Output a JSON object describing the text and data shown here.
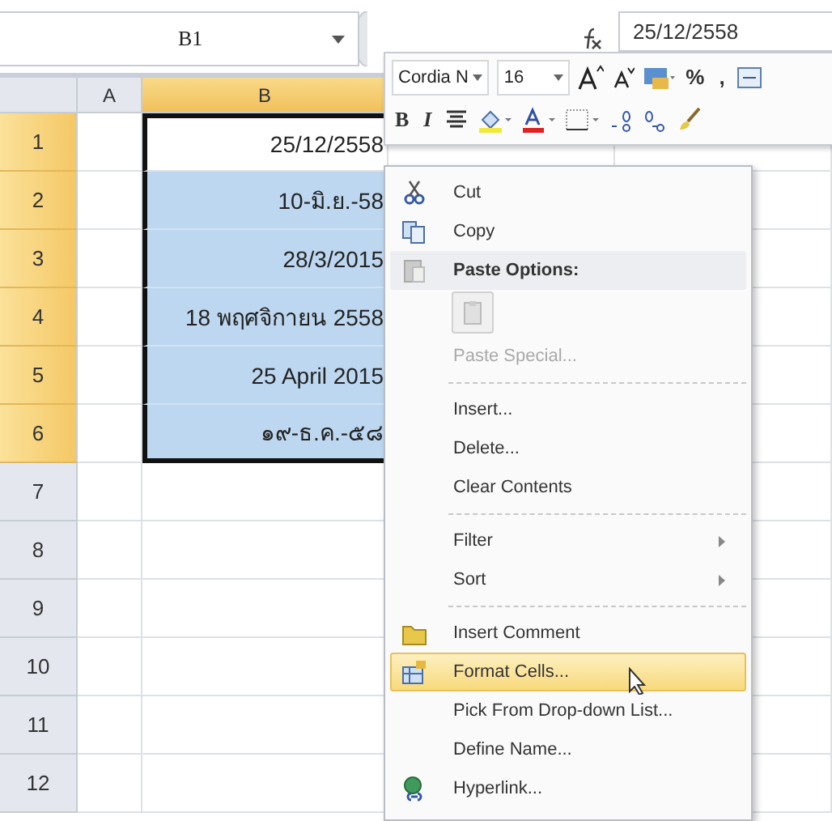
{
  "formula_bar": {
    "name_box": "B1",
    "value": "25/12/2558"
  },
  "columns": [
    {
      "label": "A",
      "selected": false
    },
    {
      "label": "B",
      "selected": true
    }
  ],
  "rows": [
    {
      "label": "1",
      "selected": true,
      "b": {
        "value": "25/12/2558",
        "in_range": true,
        "highlighted": false
      }
    },
    {
      "label": "2",
      "selected": true,
      "b": {
        "value": "10-มิ.ย.-58",
        "in_range": true,
        "highlighted": true
      }
    },
    {
      "label": "3",
      "selected": true,
      "b": {
        "value": "28/3/2015",
        "in_range": true,
        "highlighted": true
      }
    },
    {
      "label": "4",
      "selected": true,
      "b": {
        "value": "18 พฤศจิกายน 2558",
        "in_range": true,
        "highlighted": true
      }
    },
    {
      "label": "5",
      "selected": true,
      "b": {
        "value": "25 April 2015",
        "in_range": true,
        "highlighted": true
      }
    },
    {
      "label": "6",
      "selected": true,
      "b": {
        "value": "๑๙-ธ.ค.-๕๘",
        "in_range": true,
        "highlighted": true
      }
    },
    {
      "label": "7",
      "selected": false
    },
    {
      "label": "8",
      "selected": false
    },
    {
      "label": "9",
      "selected": false
    },
    {
      "label": "10",
      "selected": false
    },
    {
      "label": "11",
      "selected": false
    },
    {
      "label": "12",
      "selected": false
    }
  ],
  "mini_toolbar": {
    "font": "Cordia N",
    "size": "16",
    "percent": "%",
    "comma": ",",
    "bold": "B",
    "italic": "I"
  },
  "context_menu": [
    {
      "kind": "cut",
      "label": "Cut",
      "selected": false
    },
    {
      "kind": "copy",
      "label": "Copy",
      "selected": false
    },
    {
      "kind": "header",
      "label": "Paste Options:"
    },
    {
      "kind": "paste-button"
    },
    {
      "kind": "disabled",
      "label": "Paste Special..."
    },
    {
      "kind": "separator"
    },
    {
      "kind": "plain",
      "label": "Insert...",
      "selected": false
    },
    {
      "kind": "plain",
      "label": "Delete...",
      "selected": false
    },
    {
      "kind": "plain",
      "label": "Clear Contents",
      "selected": false
    },
    {
      "kind": "separator"
    },
    {
      "kind": "submenu",
      "label": "Filter",
      "selected": false
    },
    {
      "kind": "submenu",
      "label": "Sort",
      "selected": false
    },
    {
      "kind": "separator"
    },
    {
      "kind": "comment",
      "label": "Insert Comment",
      "selected": false
    },
    {
      "kind": "format",
      "label": "Format Cells...",
      "selected": true
    },
    {
      "kind": "plain",
      "label": "Pick From Drop-down List...",
      "selected": false
    },
    {
      "kind": "plain",
      "label": "Define Name...",
      "selected": false
    },
    {
      "kind": "hyperlink",
      "label": "Hyperlink...",
      "selected": false
    }
  ]
}
